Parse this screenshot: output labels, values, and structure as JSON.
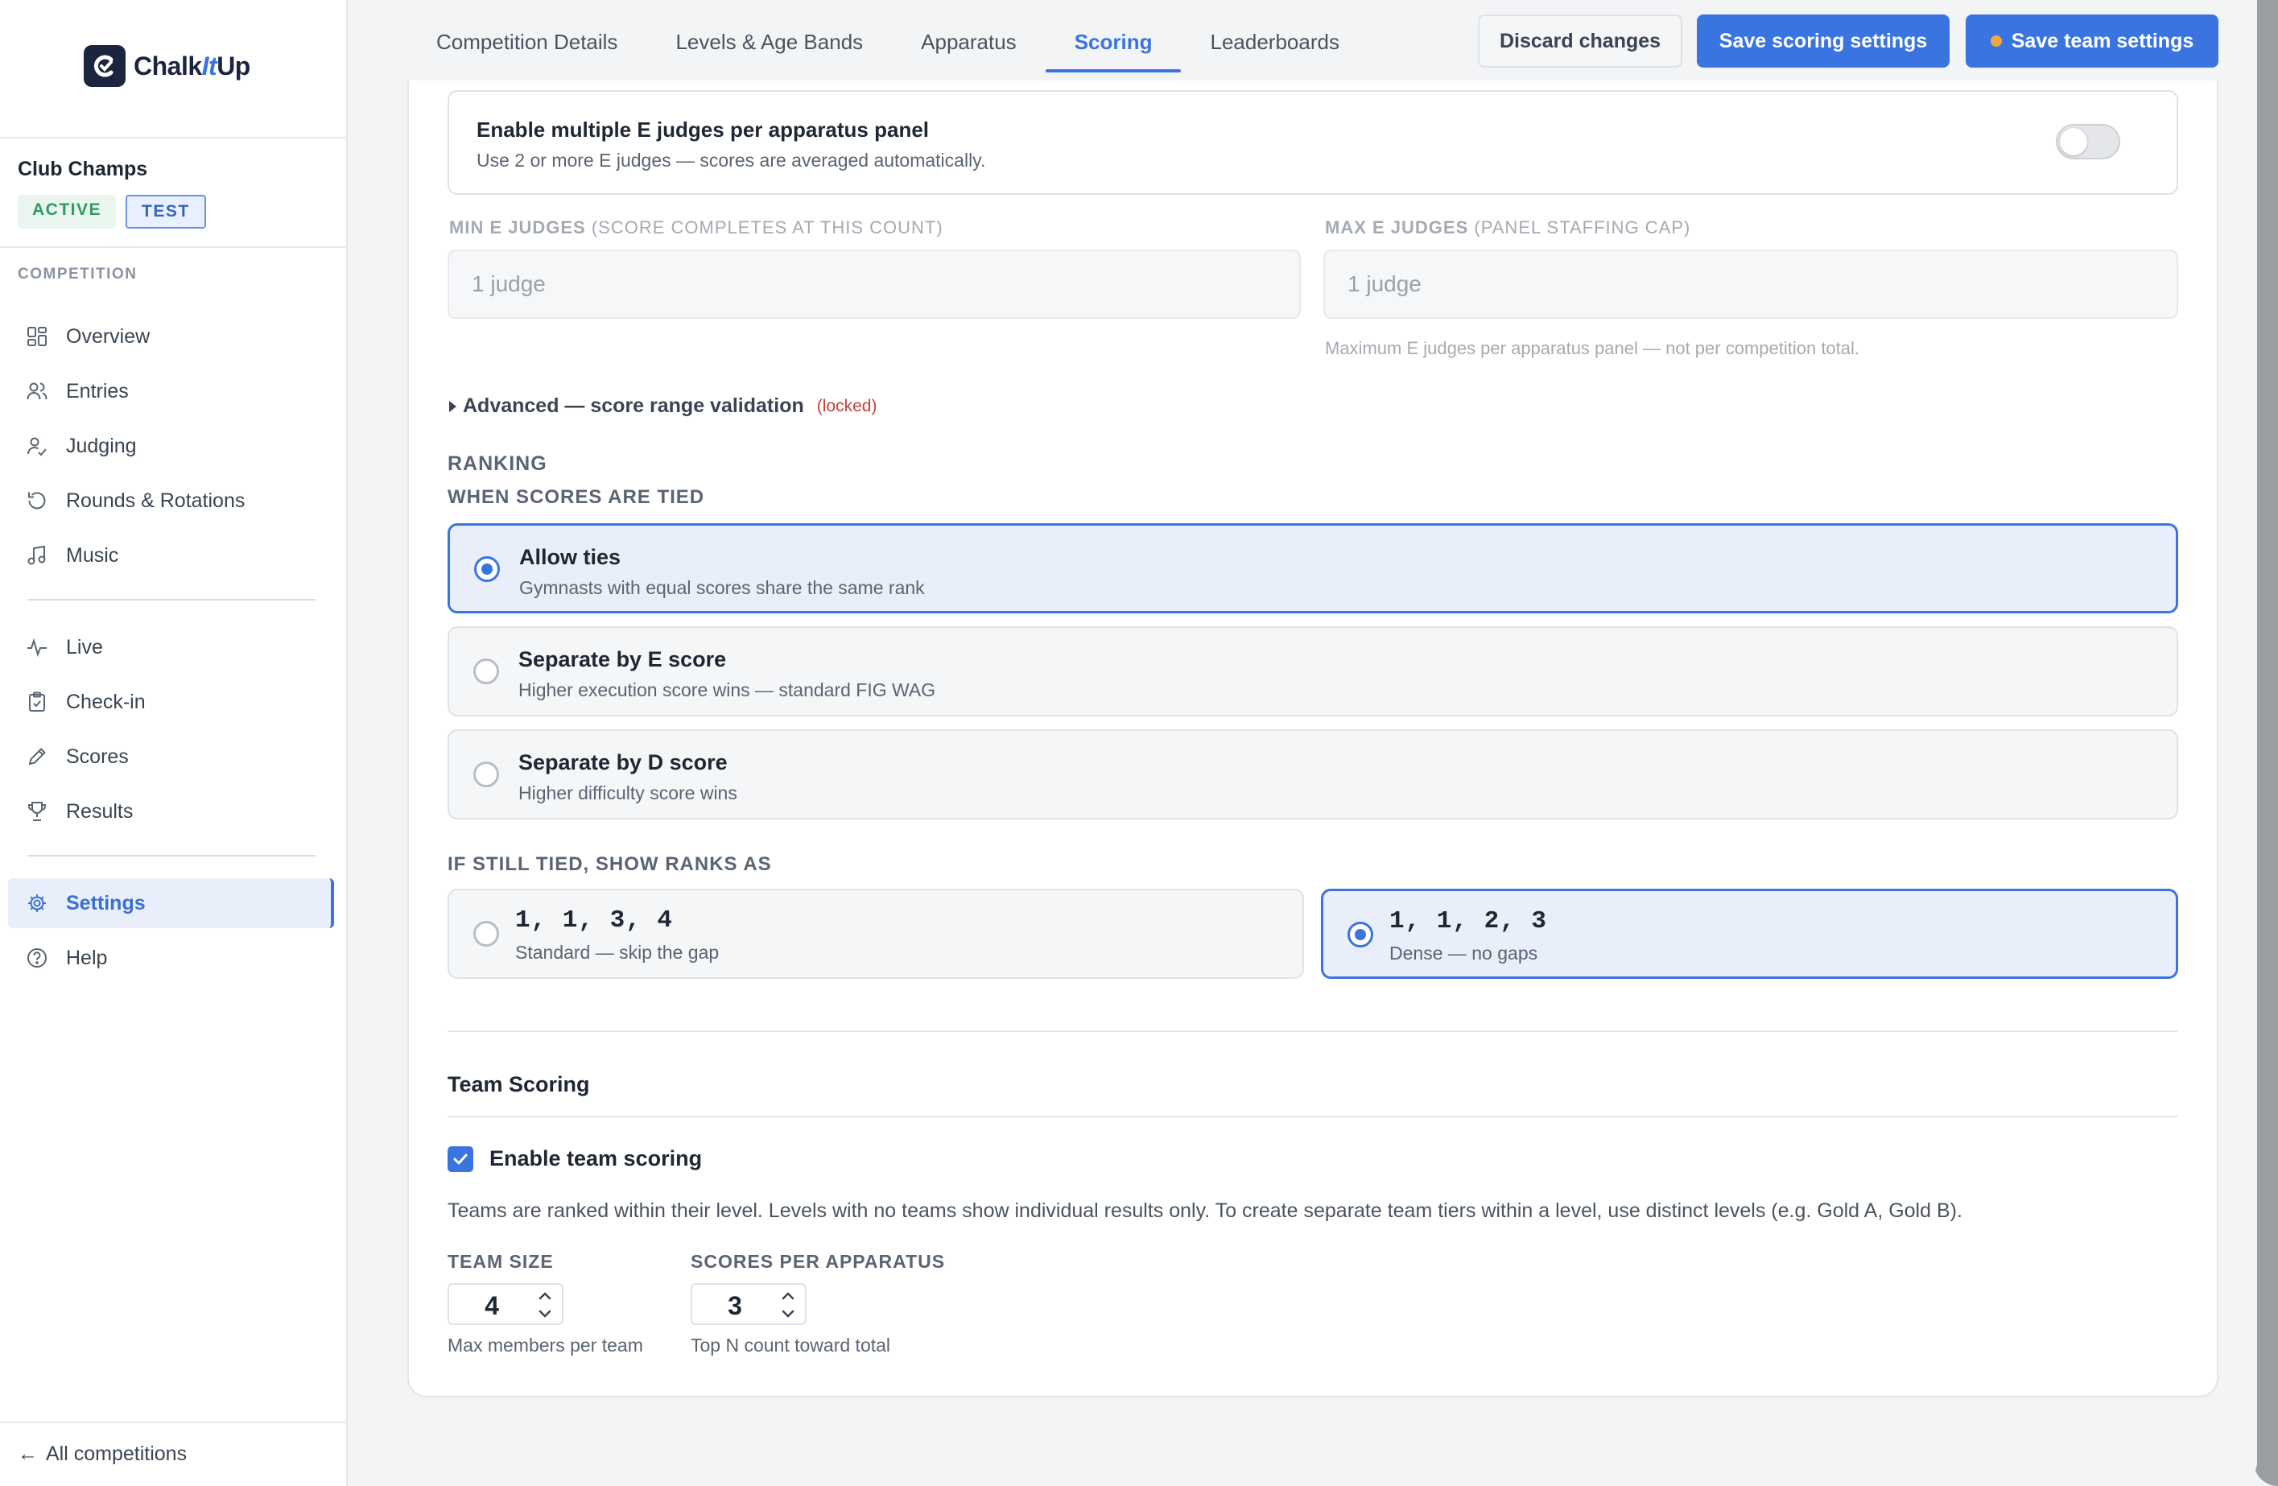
{
  "brand": {
    "name_prefix": "Chalk",
    "name_mid": "It",
    "name_suffix": "Up"
  },
  "competition": {
    "name": "Club Champs",
    "badge_active": "ACTIVE",
    "badge_test": "TEST"
  },
  "sidebar": {
    "heading": "COMPETITION",
    "items": [
      {
        "label": "Overview",
        "icon": "grid-icon"
      },
      {
        "label": "Entries",
        "icon": "users-icon"
      },
      {
        "label": "Judging",
        "icon": "judge-icon"
      },
      {
        "label": "Rounds & Rotations",
        "icon": "rotate-icon"
      },
      {
        "label": "Music",
        "icon": "music-icon"
      },
      {
        "label": "Live",
        "icon": "pulse-icon"
      },
      {
        "label": "Check-in",
        "icon": "clipboard-icon"
      },
      {
        "label": "Scores",
        "icon": "pencil-icon"
      },
      {
        "label": "Results",
        "icon": "trophy-icon"
      },
      {
        "label": "Settings",
        "icon": "gear-icon"
      },
      {
        "label": "Help",
        "icon": "help-icon"
      }
    ],
    "back_link": "All competitions"
  },
  "tabs": [
    "Competition Details",
    "Levels & Age Bands",
    "Apparatus",
    "Scoring",
    "Leaderboards"
  ],
  "active_tab": "Scoring",
  "buttons": {
    "discard": "Discard changes",
    "save_scoring": "Save scoring settings",
    "save_team": "Save team settings"
  },
  "judges": {
    "toggle_title": "Enable multiple E judges per apparatus panel",
    "toggle_sub": "Use 2 or more E judges — scores are averaged automatically.",
    "toggle_on": false,
    "min_label": "MIN E JUDGES",
    "min_label_note": "(SCORE COMPLETES AT THIS COUNT)",
    "min_value": "1 judge",
    "max_label": "MAX E JUDGES",
    "max_label_note": "(PANEL STAFFING CAP)",
    "max_value": "1 judge",
    "max_hint": "Maximum E judges per apparatus panel — not per competition total."
  },
  "advanced": {
    "label": "Advanced — score range validation",
    "locked": "(locked)"
  },
  "ranking": {
    "heading": "RANKING",
    "tie_heading": "WHEN SCORES ARE TIED",
    "options": [
      {
        "title": "Allow ties",
        "sub": "Gymnasts with equal scores share the same rank",
        "selected": true
      },
      {
        "title": "Separate by E score",
        "sub": "Higher execution score wins — standard FIG WAG",
        "selected": false
      },
      {
        "title": "Separate by D score",
        "sub": "Higher difficulty score wins",
        "selected": false
      }
    ],
    "still_tied_heading": "IF STILL TIED, SHOW RANKS AS",
    "rank_styles": [
      {
        "title": "1, 1, 3, 4",
        "sub": "Standard — skip the gap",
        "selected": false
      },
      {
        "title": "1, 1, 2, 3",
        "sub": "Dense — no gaps",
        "selected": true
      }
    ]
  },
  "team": {
    "title": "Team Scoring",
    "enable_label": "Enable team scoring",
    "enabled": true,
    "description": "Teams are ranked within their level. Levels with no teams show individual results only. To create separate team tiers within a level, use distinct levels (e.g. Gold A, Gold B).",
    "size_label": "TEAM SIZE",
    "size_value": "4",
    "size_hint": "Max members per team",
    "scores_label": "SCORES PER APPARATUS",
    "scores_value": "3",
    "scores_hint": "Top N count toward total"
  },
  "colors": {
    "accent": "#3a74e0",
    "active_badge": "#2e9b5f",
    "locked": "#c2413b",
    "unsaved_dot": "#f2a93b"
  }
}
